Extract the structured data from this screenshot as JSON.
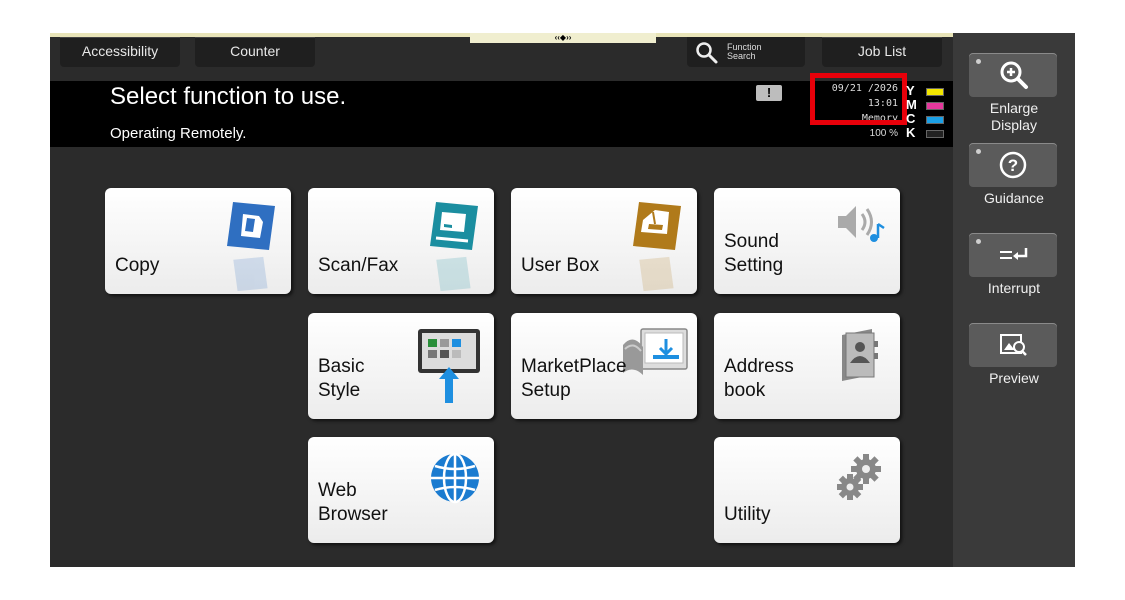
{
  "top_tabs": {
    "accessibility": "Accessibility",
    "counter": "Counter",
    "function_search_line1": "Function",
    "function_search_line2": "Search",
    "job_list": "Job List",
    "grip": "‹‹◆››"
  },
  "header": {
    "title": "Select function to use.",
    "subtitle": "Operating Remotely.",
    "warning_symbol": "!"
  },
  "status": {
    "date": "09/21 /2026",
    "time": "13:01",
    "memory_label": "Memory",
    "memory_percent": "100 %",
    "toner": [
      {
        "letter": "Y",
        "color": "#f2e600"
      },
      {
        "letter": "M",
        "color": "#e5389c"
      },
      {
        "letter": "C",
        "color": "#1aa0e6"
      },
      {
        "letter": "K",
        "color": "#222222"
      }
    ]
  },
  "side_panel": {
    "enlarge_display": "Enlarge\nDisplay",
    "guidance": "Guidance",
    "interrupt": "Interrupt",
    "preview": "Preview"
  },
  "tiles": {
    "copy": "Copy",
    "scan_fax": "Scan/Fax",
    "user_box": "User Box",
    "sound_setting": "Sound\nSetting",
    "basic_style": "Basic\nStyle",
    "marketplace_setup": "MarketPlace\nSetup",
    "address_book": "Address\nbook",
    "web_browser": "Web\nBrowser",
    "utility": "Utility"
  },
  "colors": {
    "highlight_box": "#e8000a",
    "copy_icon": "#2f6fc1",
    "scan_icon": "#1b8ea0",
    "userbox_icon": "#b07a1a",
    "browser_icon": "#1a7bd0"
  }
}
